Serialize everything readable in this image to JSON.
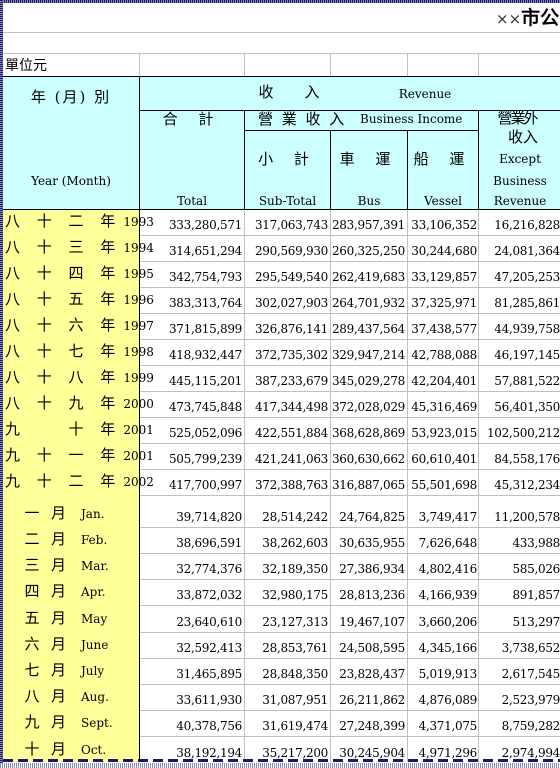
{
  "title": {
    "prefix": "××",
    "text": "市公"
  },
  "unit_label": "單位元",
  "header": {
    "year_zh": "年 (月) 別",
    "year_en": "Year (Month)",
    "revenue_zh": "收　入",
    "revenue_en": "Revenue",
    "total_zh": "合 計",
    "total_en": "Total",
    "business_income_zh": "營 業 收 入",
    "business_income_en": "Business Income",
    "subtotal_zh": "小 計",
    "subtotal_en": "Sub-Total",
    "bus_zh": "車 運",
    "bus_en": "Bus",
    "vessel_zh": "船 運",
    "vessel_en": "Vessel",
    "nonbiz_zh_1": "營業外",
    "nonbiz_zh_2": "收入",
    "nonbiz_en_1": "Except",
    "nonbiz_en_2": "Business",
    "nonbiz_en_3": "Revenue"
  },
  "years": [
    {
      "zh": "八 十 二 年",
      "en": "1993",
      "total": "333,280,571",
      "subtotal": "317,063,743",
      "bus": "283,957,391",
      "vessel": "33,106,352",
      "nonbiz": "16,216,828"
    },
    {
      "zh": "八 十 三 年",
      "en": "1994",
      "total": "314,651,294",
      "subtotal": "290,569,930",
      "bus": "260,325,250",
      "vessel": "30,244,680",
      "nonbiz": "24,081,364"
    },
    {
      "zh": "八 十 四 年",
      "en": "1995",
      "total": "342,754,793",
      "subtotal": "295,549,540",
      "bus": "262,419,683",
      "vessel": "33,129,857",
      "nonbiz": "47,205,253"
    },
    {
      "zh": "八 十 五 年",
      "en": "1996",
      "total": "383,313,764",
      "subtotal": "302,027,903",
      "bus": "264,701,932",
      "vessel": "37,325,971",
      "nonbiz": "81,285,861"
    },
    {
      "zh": "八 十 六 年",
      "en": "1997",
      "total": "371,815,899",
      "subtotal": "326,876,141",
      "bus": "289,437,564",
      "vessel": "37,438,577",
      "nonbiz": "44,939,758"
    },
    {
      "zh": "八 十 七 年",
      "en": "1998",
      "total": "418,932,447",
      "subtotal": "372,735,302",
      "bus": "329,947,214",
      "vessel": "42,788,088",
      "nonbiz": "46,197,145"
    },
    {
      "zh": "八 十 八 年",
      "en": "1999",
      "total": "445,115,201",
      "subtotal": "387,233,679",
      "bus": "345,029,278",
      "vessel": "42,204,401",
      "nonbiz": "57,881,522"
    },
    {
      "zh": "八 十 九 年",
      "en": "2000",
      "total": "473,745,848",
      "subtotal": "417,344,498",
      "bus": "372,028,029",
      "vessel": "45,316,469",
      "nonbiz": "56,401,350"
    },
    {
      "zh": "九 　 十 年",
      "en": "2001",
      "total": "525,052,096",
      "subtotal": "422,551,884",
      "bus": "368,628,869",
      "vessel": "53,923,015",
      "nonbiz": "102,500,212"
    },
    {
      "zh": "九 十 一 年",
      "en": "2001",
      "total": "505,799,239",
      "subtotal": "421,241,063",
      "bus": "360,630,662",
      "vessel": "60,610,401",
      "nonbiz": "84,558,176"
    },
    {
      "zh": "九 十 二 年",
      "en": "2002",
      "total": "417,700,997",
      "subtotal": "372,388,763",
      "bus": "316,887,065",
      "vessel": "55,501,698",
      "nonbiz": "45,312,234"
    }
  ],
  "months": [
    {
      "num": "一",
      "yue": "月",
      "en": "Jan.",
      "total": "39,714,820",
      "subtotal": "28,514,242",
      "bus": "24,764,825",
      "vessel": "3,749,417",
      "nonbiz": "11,200,578"
    },
    {
      "num": "二",
      "yue": "月",
      "en": "Feb.",
      "total": "38,696,591",
      "subtotal": "38,262,603",
      "bus": "30,635,955",
      "vessel": "7,626,648",
      "nonbiz": "433,988"
    },
    {
      "num": "三",
      "yue": "月",
      "en": "Mar.",
      "total": "32,774,376",
      "subtotal": "32,189,350",
      "bus": "27,386,934",
      "vessel": "4,802,416",
      "nonbiz": "585,026"
    },
    {
      "num": "四",
      "yue": "月",
      "en": "Apr.",
      "total": "33,872,032",
      "subtotal": "32,980,175",
      "bus": "28,813,236",
      "vessel": "4,166,939",
      "nonbiz": "891,857"
    },
    {
      "num": "五",
      "yue": "月",
      "en": "May",
      "total": "23,640,610",
      "subtotal": "23,127,313",
      "bus": "19,467,107",
      "vessel": "3,660,206",
      "nonbiz": "513,297"
    },
    {
      "num": "六",
      "yue": "月",
      "en": "June",
      "total": "32,592,413",
      "subtotal": "28,853,761",
      "bus": "24,508,595",
      "vessel": "4,345,166",
      "nonbiz": "3,738,652"
    },
    {
      "num": "七",
      "yue": "月",
      "en": "July",
      "total": "31,465,895",
      "subtotal": "28,848,350",
      "bus": "23,828,437",
      "vessel": "5,019,913",
      "nonbiz": "2,617,545"
    },
    {
      "num": "八",
      "yue": "月",
      "en": "Aug.",
      "total": "33,611,930",
      "subtotal": "31,087,951",
      "bus": "26,211,862",
      "vessel": "4,876,089",
      "nonbiz": "2,523,979"
    },
    {
      "num": "九",
      "yue": "月",
      "en": "Sept.",
      "total": "40,378,756",
      "subtotal": "31,619,474",
      "bus": "27,248,399",
      "vessel": "4,371,075",
      "nonbiz": "8,759,282"
    },
    {
      "num": "十",
      "yue": "月",
      "en": "Oct.",
      "total": "38,192,194",
      "subtotal": "35,217,200",
      "bus": "30,245,904",
      "vessel": "4,971,296",
      "nonbiz": "2,974,994"
    }
  ]
}
